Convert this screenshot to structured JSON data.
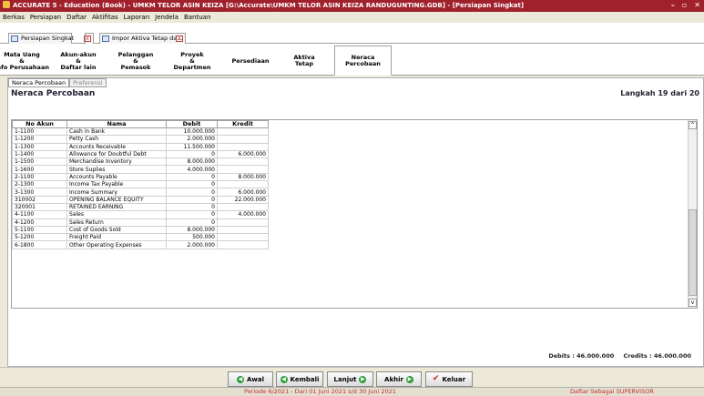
{
  "window": {
    "title": "ACCURATE 5 - Education (Book) - UMKM TELOR ASIN KEIZA  [G:\\Accurate\\UMKM TELOR ASIN KEIZA RANDUGUNTING.GDB] - [Persiapan Singkat]",
    "controls": [
      "–",
      "▫",
      "✕"
    ]
  },
  "menu": [
    "Berkas",
    "Persiapan",
    "Daftar",
    "Aktifitas",
    "Laporan",
    "Jendela",
    "Bantuan"
  ],
  "doc_tabs": [
    {
      "label": "Persiapan Singkat"
    },
    {
      "label": "Impor Aktiva Tetap da..."
    }
  ],
  "wizard_steps": [
    {
      "label": "Mata Uang\n&\nInfo Perusahaan"
    },
    {
      "label": "Akun-akun\n&\nDaftar lain"
    },
    {
      "label": "Pelanggan\n&\nPemasok"
    },
    {
      "label": "Proyek\n&\nDepartmen"
    },
    {
      "label": "Persediaan"
    },
    {
      "label": "Aktiva\nTetap"
    },
    {
      "label": "Neraca\nPercobaan"
    }
  ],
  "sub_tabs": [
    "Neraca Percobaan",
    "Preferensi"
  ],
  "section_title": "Neraca Percobaan",
  "step_counter": "Langkah 19 dari 20",
  "table": {
    "headers": [
      "No Akun",
      "Nama",
      "Debit",
      "Kredit"
    ],
    "rows": [
      [
        "1-1100",
        "Cash in Bank",
        "10.000.000",
        ""
      ],
      [
        "1-1200",
        "Petty Cash",
        "2.000.000",
        ""
      ],
      [
        "1-1300",
        "Accounts Receivable",
        "11.500.000",
        ""
      ],
      [
        "1-1400",
        "Allowance for Doubtful Debt",
        "0",
        "6.000.000"
      ],
      [
        "1-1500",
        "Merchandise Inventory",
        "8.000.000",
        ""
      ],
      [
        "1-1600",
        "Store Suplies",
        "4.000.000",
        ""
      ],
      [
        "2-1100",
        "Accounts Payable",
        "0",
        "8.000.000"
      ],
      [
        "2-1300",
        "Income Tax Payable",
        "0",
        ""
      ],
      [
        "3-1300",
        "Income Summary",
        "0",
        "6.000.000"
      ],
      [
        "310002",
        "OPENING BALANCE EQUITY",
        "0",
        "22.000.000"
      ],
      [
        "320001",
        "RETAINED EARNING",
        "0",
        ""
      ],
      [
        "4-1100",
        "Sales",
        "0",
        "4.000.000"
      ],
      [
        "4-1200",
        "Sales Return",
        "0",
        ""
      ],
      [
        "5-1100",
        "Cost of Goods Sold",
        "8.000.000",
        ""
      ],
      [
        "5-1200",
        "Freight Paid",
        "500.000",
        ""
      ],
      [
        "6-1800",
        "Other Operating Expenses",
        "2.000.000",
        ""
      ]
    ]
  },
  "totals": {
    "debits": "Debits : 46.000.000",
    "credits": "Credits : 46.000.000"
  },
  "buttons": {
    "first": "Awal",
    "back": "Kembali",
    "next": "Lanjut",
    "last": "Akhir",
    "exit": "Keluar"
  },
  "status": {
    "period": "Periode 6/2021 - Dari 01 Juni 2021 s/d 30 Juni 2021",
    "user": "Daftar Sebagai SUPERVISOR"
  }
}
